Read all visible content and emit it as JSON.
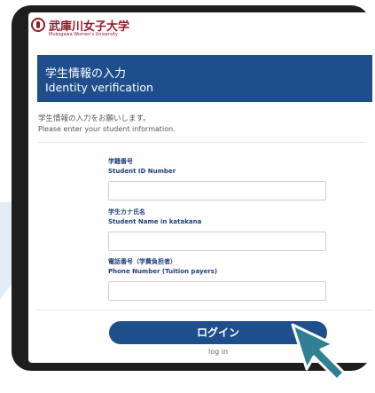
{
  "logo": {
    "name": "武庫川女子大学",
    "subtitle": "Mukogawa Women's University"
  },
  "header": {
    "title_jp": "学生情報の入力",
    "title_en": "Identity verification"
  },
  "intro": {
    "text_jp": "学生情報の入力をお願いします。",
    "text_en": "Please enter your student information."
  },
  "form": {
    "student_id": {
      "label_jp": "学籍番号",
      "label_en": "Student ID Number",
      "value": ""
    },
    "student_name": {
      "label_jp": "学生カナ氏名",
      "label_en": "Student Name in katakana",
      "value": ""
    },
    "phone": {
      "label_jp": "電話番号（学費負担者）",
      "label_en": "Phone Number (Tuition payers)",
      "value": ""
    }
  },
  "login": {
    "label": "ログイン",
    "sublabel": "log in"
  },
  "colors": {
    "brand_blue": "#1f4e8c",
    "logo_red": "#8f1c2a",
    "cursor_teal": "#2f7f95"
  },
  "icons": {
    "pointer": "pointer-arrow-icon",
    "logo": "university-crest-icon"
  }
}
